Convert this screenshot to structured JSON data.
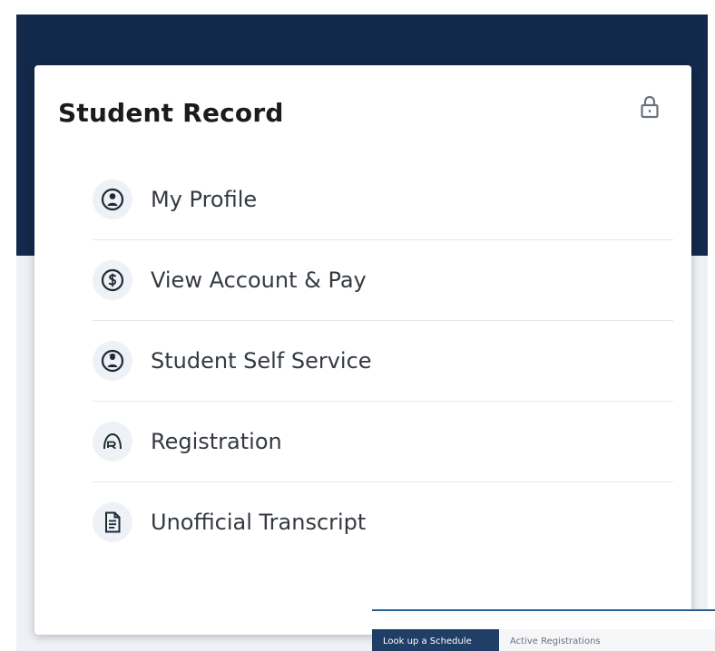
{
  "card": {
    "title": "Student Record",
    "lock_icon": "lock-icon"
  },
  "menu": {
    "items": [
      {
        "label": "My Profile",
        "icon": "profile-icon"
      },
      {
        "label": "View Account & Pay",
        "icon": "money-icon"
      },
      {
        "label": "Student Self Service",
        "icon": "student-service-icon"
      },
      {
        "label": "Registration",
        "icon": "registration-icon"
      },
      {
        "label": "Unofficial Transcript",
        "icon": "document-icon"
      }
    ]
  },
  "preview": {
    "tabs": [
      {
        "label": "Look up a Schedule"
      },
      {
        "label": "Active Registrations"
      }
    ]
  },
  "colors": {
    "header_navy": "#13294b",
    "page_background": "#ffffff",
    "card_background": "#ffffff",
    "icon_background": "#eef2f6",
    "text": "#343a40"
  }
}
